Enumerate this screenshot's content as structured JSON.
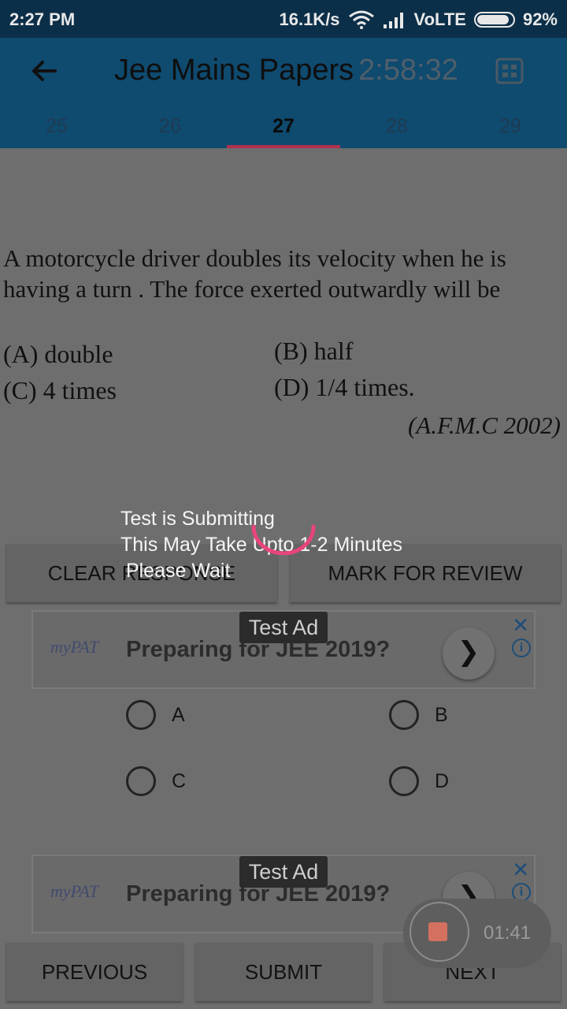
{
  "status_bar": {
    "time": "2:27 PM",
    "speed": "16.1K/s",
    "network": "VoLTE",
    "battery": "92%",
    "battery_level": 0.92
  },
  "app_bar": {
    "title": "Jee Mains Papers",
    "timer": "2:58:32",
    "back_icon": "arrow-left-icon",
    "grid_icon": "question-grid-icon"
  },
  "tabs": [
    "25",
    "26",
    "27",
    "28",
    "29"
  ],
  "active_tab": "27",
  "question": {
    "text": "A motorcycle driver doubles  its velocity when he is having a turn . The force exerted outwardly will be",
    "options": [
      {
        "label": "(A)  double"
      },
      {
        "label": "(B) half"
      },
      {
        "label": "(C)  4  times"
      },
      {
        "label": "(D)  1/4  times."
      }
    ],
    "source": "(A.F.M.C 2002)"
  },
  "buttons": {
    "clear": "CLEAR RESPONSE",
    "mark": "MARK FOR REVIEW",
    "previous": "PREVIOUS",
    "submit": "SUBMIT",
    "next": "NEXT"
  },
  "ads": [
    {
      "badge": "Test Ad",
      "brand": "myPAT",
      "headline": "Preparing for JEE 2019?"
    },
    {
      "badge": "Test Ad",
      "brand": "myPAT",
      "headline": "Preparing for JEE 2019?"
    }
  ],
  "answer_choices": [
    "A",
    "B",
    "C",
    "D"
  ],
  "overlay": {
    "line1": "Test is Submitting",
    "line2": "This May Take Upto 1-2 Minutes",
    "line3": " Please Wait"
  },
  "recorder": {
    "elapsed": "01:41"
  },
  "colors": {
    "status_bar": "#0c2f49",
    "app_bar": "#0f4a6f",
    "tab_indicator": "#b3304f",
    "spinner": "#e8457a",
    "dim_background": "#6e6e6e"
  }
}
